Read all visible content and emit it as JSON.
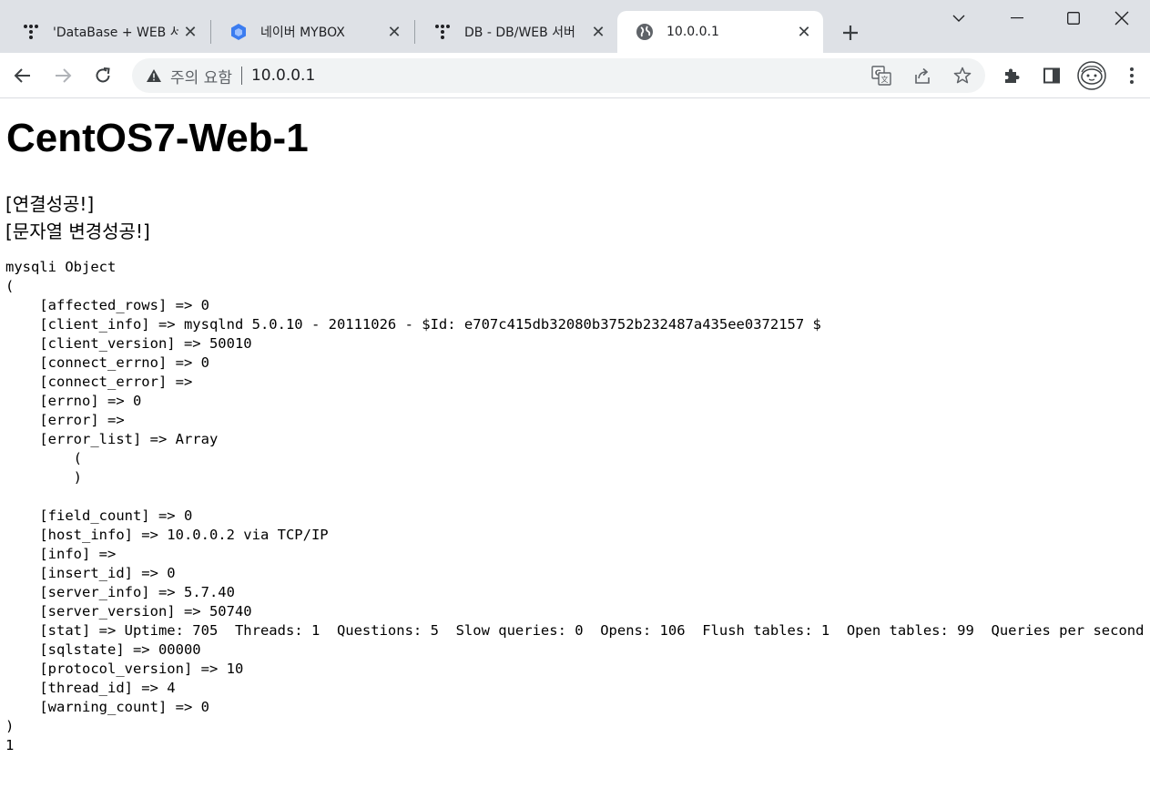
{
  "browser": {
    "tabs": [
      {
        "title": "'DataBase + WEB 서",
        "favicon": "tistory-icon",
        "active": false
      },
      {
        "title": "네이버 MYBOX",
        "favicon": "mybox-icon",
        "active": false
      },
      {
        "title": "DB - DB/WEB 서버",
        "favicon": "tistory-icon",
        "active": false
      },
      {
        "title": "10.0.0.1",
        "favicon": "globe-icon",
        "active": true
      }
    ],
    "omnibox": {
      "security_label": "주의 요함",
      "url": "10.0.0.1"
    }
  },
  "page": {
    "title": "CentOS7-Web-1",
    "messages": [
      "[연결성공!]",
      "[문자열 변경성공!]"
    ],
    "dump_lines": [
      "mysqli Object",
      "(",
      "    [affected_rows] => 0",
      "    [client_info] => mysqlnd 5.0.10 - 20111026 - $Id: e707c415db32080b3752b232487a435ee0372157 $",
      "    [client_version] => 50010",
      "    [connect_errno] => 0",
      "    [connect_error] =>",
      "    [errno] => 0",
      "    [error] =>",
      "    [error_list] => Array",
      "        (",
      "        )",
      "",
      "    [field_count] => 0",
      "    [host_info] => 10.0.0.2 via TCP/IP",
      "    [info] =>",
      "    [insert_id] => 0",
      "    [server_info] => 5.7.40",
      "    [server_version] => 50740",
      "    [stat] => Uptime: 705  Threads: 1  Questions: 5  Slow queries: 0  Opens: 106  Flush tables: 1  Open tables: 99  Queries per second avg:",
      "    [sqlstate] => 00000",
      "    [protocol_version] => 10",
      "    [thread_id] => 4",
      "    [warning_count] => 0",
      ")",
      "1"
    ]
  }
}
